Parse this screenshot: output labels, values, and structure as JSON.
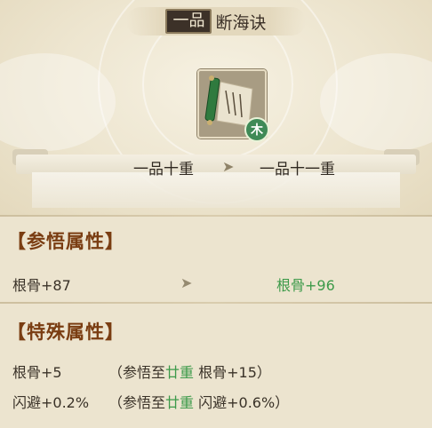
{
  "header": {
    "grade_badge": "一品",
    "skill_name": "断海诀"
  },
  "item": {
    "icon": "scroll-icon",
    "element_badge": "木"
  },
  "rank": {
    "from": "一品十重",
    "arrow": "➤",
    "to": "一品十一重"
  },
  "comprehension": {
    "title": "【参悟属性】",
    "current": "根骨+87",
    "arrow": "➤",
    "next": "根骨+96"
  },
  "special": {
    "title": "【特殊属性】",
    "rows": [
      {
        "stat": "根骨+5",
        "prefix": "（参悟至",
        "level": "廿重",
        "bonus": "根骨+15）"
      },
      {
        "stat": "闪避+0.2%",
        "prefix": "（参悟至",
        "level": "廿重",
        "bonus": "闪避+0.6%）"
      }
    ]
  },
  "colors": {
    "title_brown": "#7a3d12",
    "green": "#3d9a4a",
    "element_green": "#3f8a57"
  }
}
